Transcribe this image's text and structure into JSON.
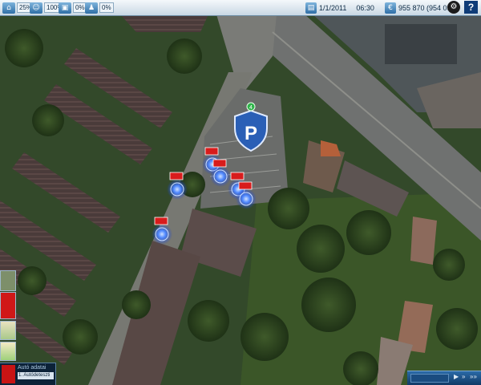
{
  "hud": {
    "stats": [
      {
        "icon": "building-icon",
        "value": "25%"
      },
      {
        "icon": "people-icon",
        "value": "100%"
      },
      {
        "icon": "vehicle-icon",
        "value": "0%"
      },
      {
        "icon": "staff-icon",
        "value": "0%"
      }
    ],
    "date": "1/1/2011",
    "time": "06:30",
    "money": "955 870 (954 097)",
    "menu_icon": "settings-menu-icon",
    "help_label": "?"
  },
  "map": {
    "parking_badge_letter": "P",
    "parking_count": "4",
    "units": [
      {
        "name": "unit-1"
      },
      {
        "name": "unit-2"
      },
      {
        "name": "unit-3"
      },
      {
        "name": "unit-4"
      },
      {
        "name": "unit-5"
      },
      {
        "name": "unit-6"
      }
    ]
  },
  "left_panel": {
    "vehicle_title": "Autó adatai",
    "vehicle_name": "1. Autódeteszti"
  },
  "timebar": {
    "controls": [
      "▶",
      "»",
      "»»"
    ]
  },
  "colors": {
    "hud_bg": "#dde8f0",
    "accent": "#2f6fa6",
    "parking_blue": "#2a5fb6",
    "unit_glow": "#3f7bff",
    "unit_flag": "#d81c1c"
  }
}
